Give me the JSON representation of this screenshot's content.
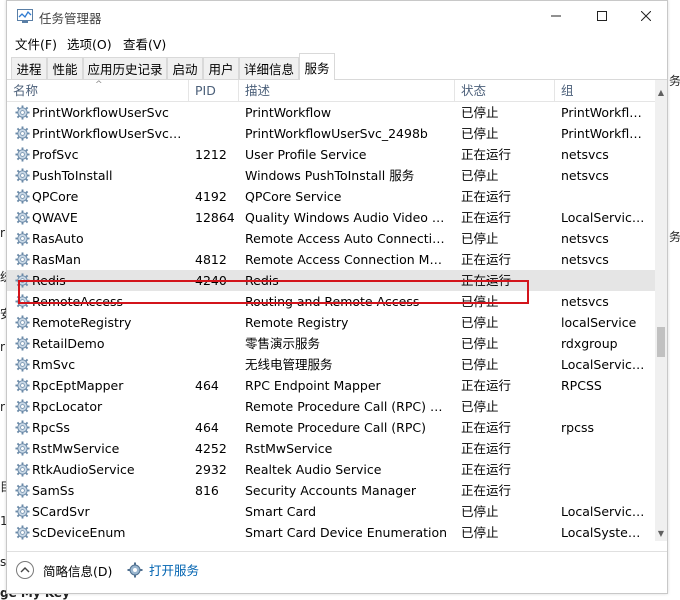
{
  "window": {
    "title": "任务管理器",
    "controls": {
      "minimize": "—",
      "maximize": "☐",
      "close": "✕"
    }
  },
  "menu": [
    "文件(F)",
    "选项(O)",
    "查看(V)"
  ],
  "tabs": [
    {
      "label": "进程",
      "active": false
    },
    {
      "label": "性能",
      "active": false
    },
    {
      "label": "应用历史记录",
      "active": false
    },
    {
      "label": "启动",
      "active": false
    },
    {
      "label": "用户",
      "active": false
    },
    {
      "label": "详细信息",
      "active": false
    },
    {
      "label": "服务",
      "active": true
    }
  ],
  "columns": [
    "名称",
    "PID",
    "描述",
    "状态",
    "组"
  ],
  "sort_indicator": "^",
  "rows": [
    {
      "name": "PrintWorkflowUserSvc",
      "pid": "",
      "desc": "PrintWorkflow",
      "status": "已停止",
      "group": "PrintWorkflow"
    },
    {
      "name": "PrintWorkflowUserSvc_2...",
      "pid": "",
      "desc": "PrintWorkflowUserSvc_2498b",
      "status": "已停止",
      "group": "PrintWorkflow"
    },
    {
      "name": "ProfSvc",
      "pid": "1212",
      "desc": "User Profile Service",
      "status": "正在运行",
      "group": "netsvcs"
    },
    {
      "name": "PushToInstall",
      "pid": "",
      "desc": "Windows PushToInstall 服务",
      "status": "已停止",
      "group": "netsvcs"
    },
    {
      "name": "QPCore",
      "pid": "4192",
      "desc": "QPCore Service",
      "status": "正在运行",
      "group": ""
    },
    {
      "name": "QWAVE",
      "pid": "12864",
      "desc": "Quality Windows Audio Video Ex...",
      "status": "正在运行",
      "group": "LocalService..."
    },
    {
      "name": "RasAuto",
      "pid": "",
      "desc": "Remote Access Auto Connection ...",
      "status": "已停止",
      "group": "netsvcs"
    },
    {
      "name": "RasMan",
      "pid": "4812",
      "desc": "Remote Access Connection Man...",
      "status": "正在运行",
      "group": "netsvcs"
    },
    {
      "name": "Redis",
      "pid": "4240",
      "desc": "Redis",
      "status": "正在运行",
      "group": "",
      "selected": true
    },
    {
      "name": "RemoteAccess",
      "pid": "",
      "desc": "Routing and Remote Access",
      "status": "已停止",
      "group": "netsvcs"
    },
    {
      "name": "RemoteRegistry",
      "pid": "",
      "desc": "Remote Registry",
      "status": "已停止",
      "group": "localService"
    },
    {
      "name": "RetailDemo",
      "pid": "",
      "desc": "零售演示服务",
      "status": "已停止",
      "group": "rdxgroup"
    },
    {
      "name": "RmSvc",
      "pid": "",
      "desc": "无线电管理服务",
      "status": "已停止",
      "group": "LocalService..."
    },
    {
      "name": "RpcEptMapper",
      "pid": "464",
      "desc": "RPC Endpoint Mapper",
      "status": "正在运行",
      "group": "RPCSS"
    },
    {
      "name": "RpcLocator",
      "pid": "",
      "desc": "Remote Procedure Call (RPC) Loc...",
      "status": "已停止",
      "group": ""
    },
    {
      "name": "RpcSs",
      "pid": "464",
      "desc": "Remote Procedure Call (RPC)",
      "status": "正在运行",
      "group": "rpcss"
    },
    {
      "name": "RstMwService",
      "pid": "4252",
      "desc": "RstMwService",
      "status": "正在运行",
      "group": ""
    },
    {
      "name": "RtkAudioService",
      "pid": "2932",
      "desc": "Realtek Audio Service",
      "status": "正在运行",
      "group": ""
    },
    {
      "name": "SamSs",
      "pid": "816",
      "desc": "Security Accounts Manager",
      "status": "正在运行",
      "group": ""
    },
    {
      "name": "SCardSvr",
      "pid": "",
      "desc": "Smart Card",
      "status": "已停止",
      "group": "LocalService..."
    },
    {
      "name": "ScDeviceEnum",
      "pid": "",
      "desc": "Smart Card Device Enumeration",
      "status": "已停止",
      "group": "LocalSystem..."
    }
  ],
  "footer": {
    "brief": "简略信息(D)",
    "open_services": "打开服务"
  },
  "background": {
    "left": [
      "r",
      "统",
      "安",
      "r",
      "r",
      "目",
      "1",
      "s"
    ],
    "right": [
      "务",
      "务"
    ],
    "bottom": "ge My Key"
  },
  "colors": {
    "highlight_border": "#d3141b",
    "selected_row": "#e5e5e5",
    "link": "#0063b1",
    "header_text": "#4c607a"
  }
}
